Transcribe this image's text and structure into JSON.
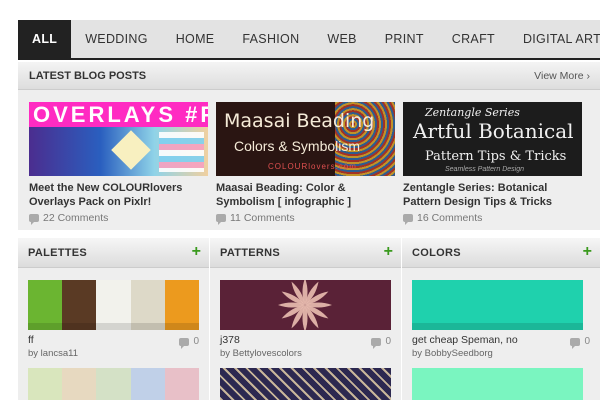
{
  "nav": {
    "items": [
      "ALL",
      "WEDDING",
      "HOME",
      "FASHION",
      "WEB",
      "PRINT",
      "CRAFT",
      "DIGITAL ART"
    ],
    "active": "ALL"
  },
  "blog": {
    "title": "LATEST BLOG POSTS",
    "view_more": "View More ›",
    "posts": [
      {
        "title": "Meet the New COLOURlovers Overlays Pack on Pixlr!",
        "comments": "22 Comments",
        "image_text": [
          "OVERLAYS",
          "#P"
        ]
      },
      {
        "title": "Maasai Beading: Color & Symbolism [ infographic ]",
        "comments": "11 Comments",
        "image_text": [
          "Maasai Beading",
          "Colors & Symbolism",
          "COLOURlovers.com"
        ]
      },
      {
        "title": "Zentangle Series: Botanical Pattern Design Tips & Tricks",
        "comments": "16 Comments",
        "image_text": [
          "Zentangle Series",
          "Artful Botanical",
          "Pattern Tips & Tricks",
          "Seamless Pattern Design"
        ]
      }
    ]
  },
  "columns": [
    {
      "title": "PALETTES",
      "plus": "+",
      "item": {
        "name": "ff",
        "by": "by lancsa11",
        "count": "0",
        "colors": [
          "#6bb531",
          "#5a3a24",
          "#f2f2ec",
          "#ddd9c8",
          "#ec9a1e"
        ]
      },
      "next_colors": [
        "#d9e6bd",
        "#e7d9c0",
        "#d4e1c6",
        "#c0d0e8",
        "#e8c0c8"
      ]
    },
    {
      "title": "PATTERNS",
      "plus": "+",
      "item": {
        "name": "j378",
        "by": "by Bettylovescolors",
        "count": "0",
        "colors": [
          "#5a2237",
          "#f3c8b8"
        ]
      },
      "next_colors": [
        "#2c2850",
        "#c8b69a"
      ]
    },
    {
      "title": "COLORS",
      "plus": "+",
      "item": {
        "name": "get cheap Speman, no",
        "by": "by BobbySeedborg",
        "count": "0",
        "colors": [
          "#1fd1ad"
        ]
      },
      "next_colors": [
        "#7af5c0"
      ]
    }
  ]
}
